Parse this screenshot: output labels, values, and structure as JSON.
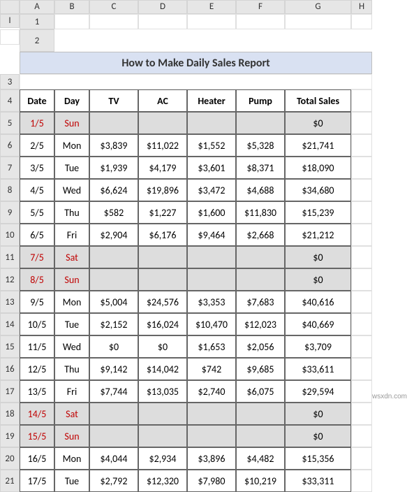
{
  "columns": [
    "",
    "A",
    "B",
    "C",
    "D",
    "E",
    "F",
    "G",
    "H",
    "I"
  ],
  "rowNumbers": [
    "1",
    "2",
    "3",
    "4",
    "5",
    "6",
    "7",
    "8",
    "9",
    "10",
    "11",
    "12",
    "13",
    "14",
    "15",
    "16",
    "17",
    "18",
    "19",
    "20",
    "21"
  ],
  "title": "How to Make Daily Sales Report",
  "headers": {
    "date": "Date",
    "day": "Day",
    "tv": "TV",
    "ac": "AC",
    "heater": "Heater",
    "pump": "Pump",
    "total": "Total Sales"
  },
  "watermark": "wsxdn.com",
  "chart_data": {
    "type": "table",
    "title": "How to Make Daily Sales Report",
    "columns": [
      "Date",
      "Day",
      "TV",
      "AC",
      "Heater",
      "Pump",
      "Total Sales"
    ],
    "rows": [
      {
        "date": "1/5",
        "day": "Sun",
        "tv": "",
        "ac": "",
        "heater": "",
        "pump": "",
        "total": "$0",
        "weekend": true
      },
      {
        "date": "2/5",
        "day": "Mon",
        "tv": "$3,839",
        "ac": "$11,022",
        "heater": "$1,552",
        "pump": "$5,328",
        "total": "$21,741",
        "weekend": false
      },
      {
        "date": "3/5",
        "day": "Tue",
        "tv": "$1,939",
        "ac": "$4,179",
        "heater": "$3,601",
        "pump": "$8,371",
        "total": "$18,090",
        "weekend": false
      },
      {
        "date": "4/5",
        "day": "Wed",
        "tv": "$6,624",
        "ac": "$19,896",
        "heater": "$3,472",
        "pump": "$4,688",
        "total": "$34,680",
        "weekend": false
      },
      {
        "date": "5/5",
        "day": "Thu",
        "tv": "$582",
        "ac": "$1,227",
        "heater": "$1,600",
        "pump": "$11,830",
        "total": "$15,239",
        "weekend": false
      },
      {
        "date": "6/5",
        "day": "Fri",
        "tv": "$2,904",
        "ac": "$6,176",
        "heater": "$9,464",
        "pump": "$2,668",
        "total": "$21,212",
        "weekend": false
      },
      {
        "date": "7/5",
        "day": "Sat",
        "tv": "",
        "ac": "",
        "heater": "",
        "pump": "",
        "total": "$0",
        "weekend": true
      },
      {
        "date": "8/5",
        "day": "Sun",
        "tv": "",
        "ac": "",
        "heater": "",
        "pump": "",
        "total": "$0",
        "weekend": true
      },
      {
        "date": "9/5",
        "day": "Mon",
        "tv": "$5,004",
        "ac": "$24,576",
        "heater": "$3,353",
        "pump": "$7,683",
        "total": "$40,616",
        "weekend": false
      },
      {
        "date": "10/5",
        "day": "Tue",
        "tv": "$2,152",
        "ac": "$16,024",
        "heater": "$10,470",
        "pump": "$12,023",
        "total": "$40,669",
        "weekend": false
      },
      {
        "date": "11/5",
        "day": "Wed",
        "tv": "$0",
        "ac": "$0",
        "heater": "$1,653",
        "pump": "$2,056",
        "total": "$3,709",
        "weekend": false
      },
      {
        "date": "12/5",
        "day": "Thu",
        "tv": "$9,142",
        "ac": "$14,042",
        "heater": "$742",
        "pump": "$9,685",
        "total": "$33,611",
        "weekend": false
      },
      {
        "date": "13/5",
        "day": "Fri",
        "tv": "$7,744",
        "ac": "$13,035",
        "heater": "$2,740",
        "pump": "$6,075",
        "total": "$29,594",
        "weekend": false
      },
      {
        "date": "14/5",
        "day": "Sat",
        "tv": "",
        "ac": "",
        "heater": "",
        "pump": "",
        "total": "$0",
        "weekend": true
      },
      {
        "date": "15/5",
        "day": "Sun",
        "tv": "",
        "ac": "",
        "heater": "",
        "pump": "",
        "total": "$0",
        "weekend": true
      },
      {
        "date": "16/5",
        "day": "Mon",
        "tv": "$4,044",
        "ac": "$2,934",
        "heater": "$3,896",
        "pump": "$4,482",
        "total": "$15,356",
        "weekend": false
      },
      {
        "date": "17/5",
        "day": "Tue",
        "tv": "$2,792",
        "ac": "$12,320",
        "heater": "$7,980",
        "pump": "$10,219",
        "total": "$33,311",
        "weekend": false
      }
    ]
  }
}
